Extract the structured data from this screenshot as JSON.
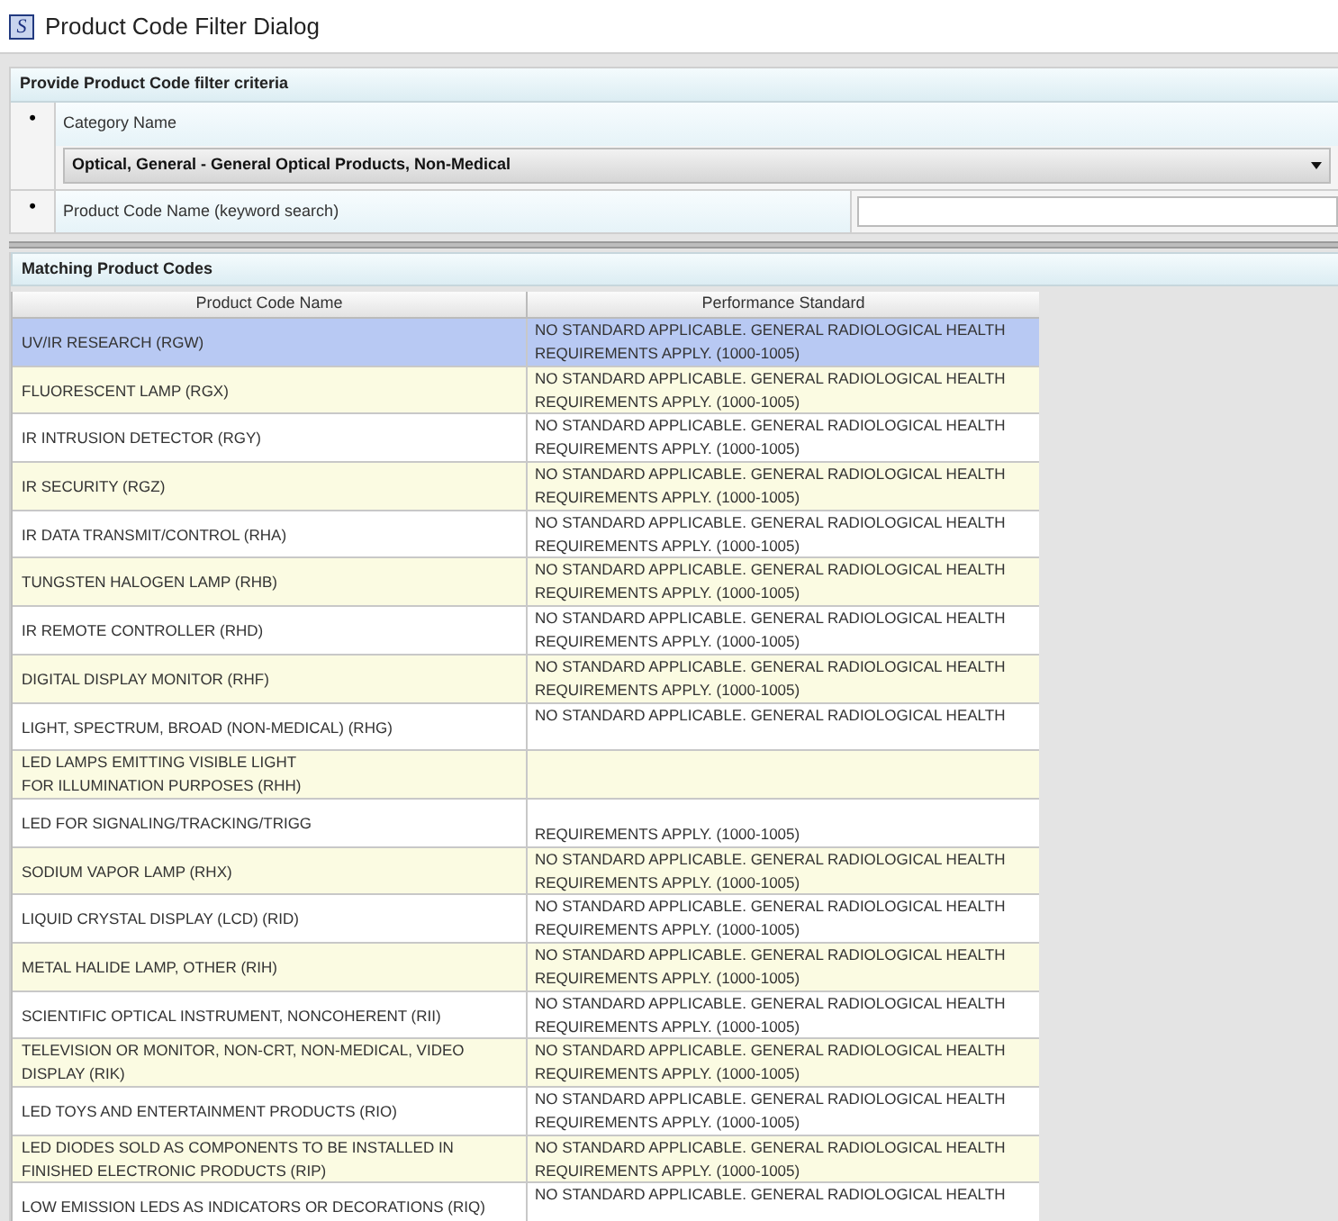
{
  "window": {
    "icon_letter": "S",
    "title": "Product Code Filter Dialog"
  },
  "filter_panel": {
    "title": "Provide Product Code filter criteria",
    "category": {
      "bullet": "•",
      "label": "Category Name",
      "value": "Optical, General - General Optical Products, Non-Medical"
    },
    "keyword": {
      "bullet": "•",
      "label": "Product Code Name (keyword search)"
    }
  },
  "results_panel": {
    "title": "Matching Product Codes",
    "table": {
      "columns": [
        "Product Code Name",
        "Performance Standard"
      ],
      "rows": [
        {
          "name_lines": [
            "UV/IR RESEARCH (RGW)"
          ],
          "standard_line_1": "NO STANDARD APPLICABLE. GENERAL RADIOLOGICAL HEALTH",
          "standard_line_2": "REQUIREMENTS APPLY. (1000-1005)",
          "selected": true
        },
        {
          "name_lines": [
            "FLUORESCENT LAMP (RGX)"
          ],
          "standard_line_1": "NO STANDARD APPLICABLE. GENERAL RADIOLOGICAL HEALTH",
          "standard_line_2": "REQUIREMENTS APPLY. (1000-1005)",
          "selected": false
        },
        {
          "name_lines": [
            "IR INTRUSION DETECTOR (RGY)"
          ],
          "standard_line_1": "NO STANDARD APPLICABLE. GENERAL RADIOLOGICAL HEALTH",
          "standard_line_2": "REQUIREMENTS APPLY. (1000-1005)",
          "selected": false
        },
        {
          "name_lines": [
            "IR SECURITY (RGZ)"
          ],
          "standard_line_1": "NO STANDARD APPLICABLE. GENERAL RADIOLOGICAL HEALTH",
          "standard_line_2": "REQUIREMENTS APPLY. (1000-1005)",
          "selected": false
        },
        {
          "name_lines": [
            "IR DATA TRANSMIT/CONTROL (RHA)"
          ],
          "standard_line_1": "NO STANDARD APPLICABLE. GENERAL RADIOLOGICAL HEALTH",
          "standard_line_2": "REQUIREMENTS APPLY. (1000-1005)",
          "selected": false
        },
        {
          "name_lines": [
            "TUNGSTEN HALOGEN LAMP (RHB)"
          ],
          "standard_line_1": "NO STANDARD APPLICABLE. GENERAL RADIOLOGICAL HEALTH",
          "standard_line_2": "REQUIREMENTS APPLY. (1000-1005)",
          "selected": false
        },
        {
          "name_lines": [
            "IR REMOTE CONTROLLER (RHD)"
          ],
          "standard_line_1": "NO STANDARD APPLICABLE. GENERAL RADIOLOGICAL HEALTH",
          "standard_line_2": "REQUIREMENTS APPLY. (1000-1005)",
          "selected": false
        },
        {
          "name_lines": [
            "DIGITAL DISPLAY MONITOR (RHF)"
          ],
          "standard_line_1": "NO STANDARD APPLICABLE. GENERAL RADIOLOGICAL HEALTH",
          "standard_line_2": "REQUIREMENTS APPLY. (1000-1005)",
          "selected": false
        },
        {
          "name_lines": [
            "LIGHT, SPECTRUM, BROAD (NON-MEDICAL) (RHG)"
          ],
          "standard_line_1": "NO STANDARD APPLICABLE. GENERAL RADIOLOGICAL HEALTH",
          "selected": false
        },
        {
          "name_lines": [
            "LED LAMPS EMITTING VISIBLE LIGHT",
            "FOR ILLUMINATION PURPOSES (RHH)"
          ],
          "selected": false
        },
        {
          "name_lines": [
            "LED FOR SIGNALING/TRACKING/TRIGG"
          ],
          "standard_line_2": "REQUIREMENTS APPLY. (1000-1005)",
          "selected": false
        },
        {
          "name_lines": [
            "SODIUM VAPOR LAMP (RHX)"
          ],
          "standard_line_1": "NO STANDARD APPLICABLE. GENERAL RADIOLOGICAL HEALTH",
          "standard_line_2": "REQUIREMENTS APPLY. (1000-1005)",
          "selected": false
        },
        {
          "name_lines": [
            "LIQUID CRYSTAL DISPLAY (LCD) (RID)"
          ],
          "standard_line_1": "NO STANDARD APPLICABLE. GENERAL RADIOLOGICAL HEALTH",
          "standard_line_2": "REQUIREMENTS APPLY. (1000-1005)",
          "selected": false
        },
        {
          "name_lines": [
            "METAL HALIDE LAMP, OTHER (RIH)"
          ],
          "standard_line_1": "NO STANDARD APPLICABLE. GENERAL RADIOLOGICAL HEALTH",
          "standard_line_2": "REQUIREMENTS APPLY. (1000-1005)",
          "selected": false
        },
        {
          "name_lines": [
            "SCIENTIFIC OPTICAL INSTRUMENT, NONCOHERENT (RII)"
          ],
          "standard_line_1": "NO STANDARD APPLICABLE. GENERAL RADIOLOGICAL HEALTH",
          "standard_line_2": "REQUIREMENTS APPLY. (1000-1005)",
          "selected": false
        },
        {
          "name_lines": [
            "TELEVISION OR MONITOR, NON-CRT, NON-MEDICAL, VIDEO",
            "DISPLAY (RIK)"
          ],
          "standard_line_1": "NO STANDARD APPLICABLE. GENERAL RADIOLOGICAL HEALTH",
          "standard_line_2": "REQUIREMENTS APPLY. (1000-1005)",
          "selected": false
        },
        {
          "name_lines": [
            "LED TOYS AND ENTERTAINMENT PRODUCTS (RIO)"
          ],
          "standard_line_1": "NO STANDARD APPLICABLE. GENERAL RADIOLOGICAL HEALTH",
          "standard_line_2": "REQUIREMENTS APPLY. (1000-1005)",
          "selected": false
        },
        {
          "name_lines": [
            "LED DIODES SOLD AS COMPONENTS TO BE INSTALLED IN",
            "FINISHED ELECTRONIC PRODUCTS (RIP)"
          ],
          "standard_line_1": "NO STANDARD APPLICABLE. GENERAL RADIOLOGICAL HEALTH",
          "standard_line_2": "REQUIREMENTS APPLY. (1000-1005)",
          "selected": false
        },
        {
          "name_lines": [
            "LOW EMISSION LEDS AS INDICATORS OR DECORATIONS (RIQ)"
          ],
          "standard_line_1": "NO STANDARD APPLICABLE. GENERAL RADIOLOGICAL HEALTH",
          "selected": false
        }
      ]
    }
  }
}
